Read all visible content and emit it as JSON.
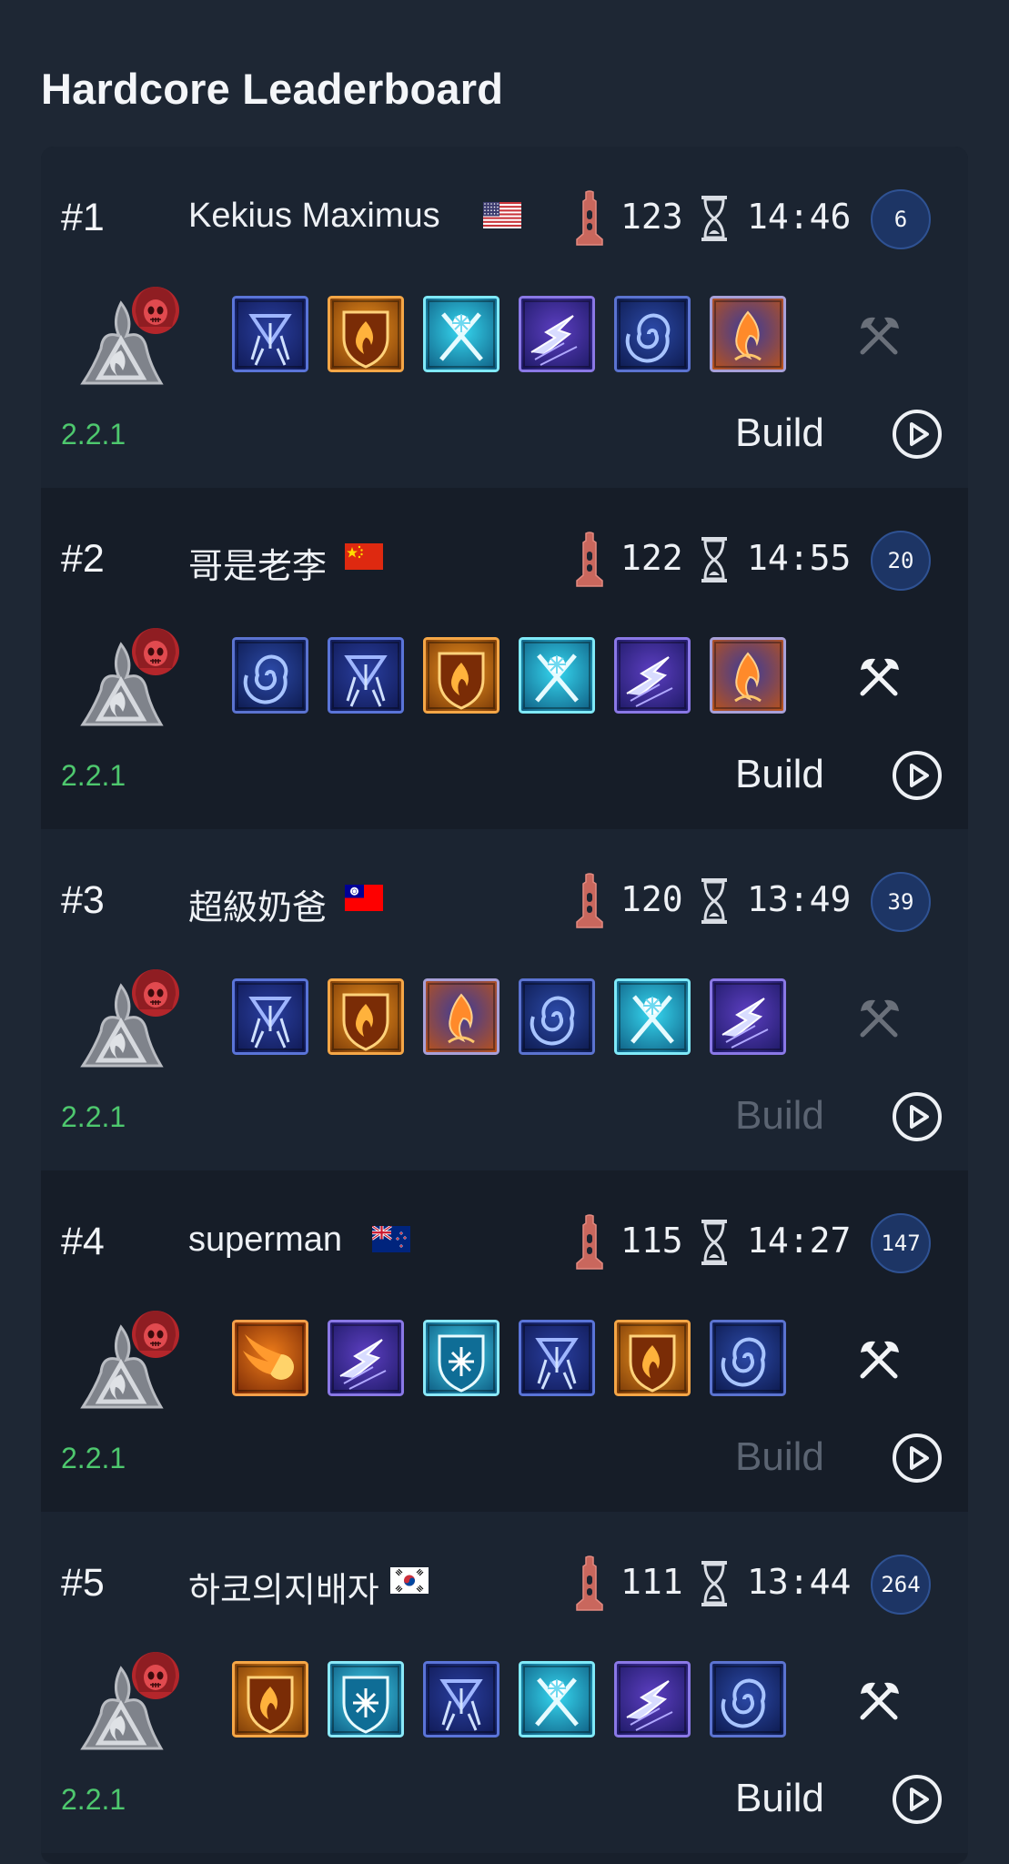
{
  "page": {
    "title": "Hardcore Leaderboard"
  },
  "colors": {
    "version_green": "#4ec86e",
    "badge_blue": "#1d3565",
    "accent_red": "#d9534f"
  },
  "entries": [
    {
      "rank": "#1",
      "name": "Kekius Maximus",
      "flag": "us-flag-icon",
      "level": "123",
      "time": "14:46",
      "badge": "6",
      "skills": [
        "lightning-spear-icon",
        "flame-shield-icon",
        "frost-blades-icon",
        "chain-lightning-icon",
        "vortex-icon",
        "fire-enchant-icon"
      ],
      "weapon_active": false,
      "version": "2.2.1",
      "build_label": "Build",
      "build_dim": false
    },
    {
      "rank": "#2",
      "name": "哥是老李",
      "flag": "cn-flag-icon",
      "level": "122",
      "time": "14:55",
      "badge": "20",
      "skills": [
        "vortex-icon",
        "lightning-spear-icon",
        "flame-shield-icon",
        "frost-blades-icon",
        "chain-lightning-icon",
        "fire-enchant-icon"
      ],
      "weapon_active": true,
      "version": "2.2.1",
      "build_label": "Build",
      "build_dim": false
    },
    {
      "rank": "#3",
      "name": "超級奶爸",
      "flag": "tw-flag-icon",
      "level": "120",
      "time": "13:49",
      "badge": "39",
      "skills": [
        "lightning-spear-icon",
        "flame-shield-icon",
        "fire-enchant-icon",
        "vortex-icon",
        "frost-blades-icon",
        "chain-lightning-icon"
      ],
      "weapon_active": false,
      "version": "2.2.1",
      "build_label": "Build",
      "build_dim": true
    },
    {
      "rank": "#4",
      "name": "superman",
      "flag": "nz-flag-icon",
      "level": "115",
      "time": "14:27",
      "badge": "147",
      "skills": [
        "fireball-icon",
        "chain-lightning-icon",
        "ice-shield-icon",
        "lightning-spear-icon",
        "flame-shield-icon",
        "vortex-icon"
      ],
      "weapon_active": true,
      "version": "2.2.1",
      "build_label": "Build",
      "build_dim": true
    },
    {
      "rank": "#5",
      "name": "하코의지배자",
      "flag": "kr-flag-icon",
      "level": "111",
      "time": "13:44",
      "badge": "264",
      "skills": [
        "flame-shield-icon",
        "ice-shield-icon",
        "lightning-spear-icon",
        "frost-blades-icon",
        "chain-lightning-icon",
        "vortex-icon"
      ],
      "weapon_active": true,
      "version": "2.2.1",
      "build_label": "Build",
      "build_dim": false
    }
  ]
}
